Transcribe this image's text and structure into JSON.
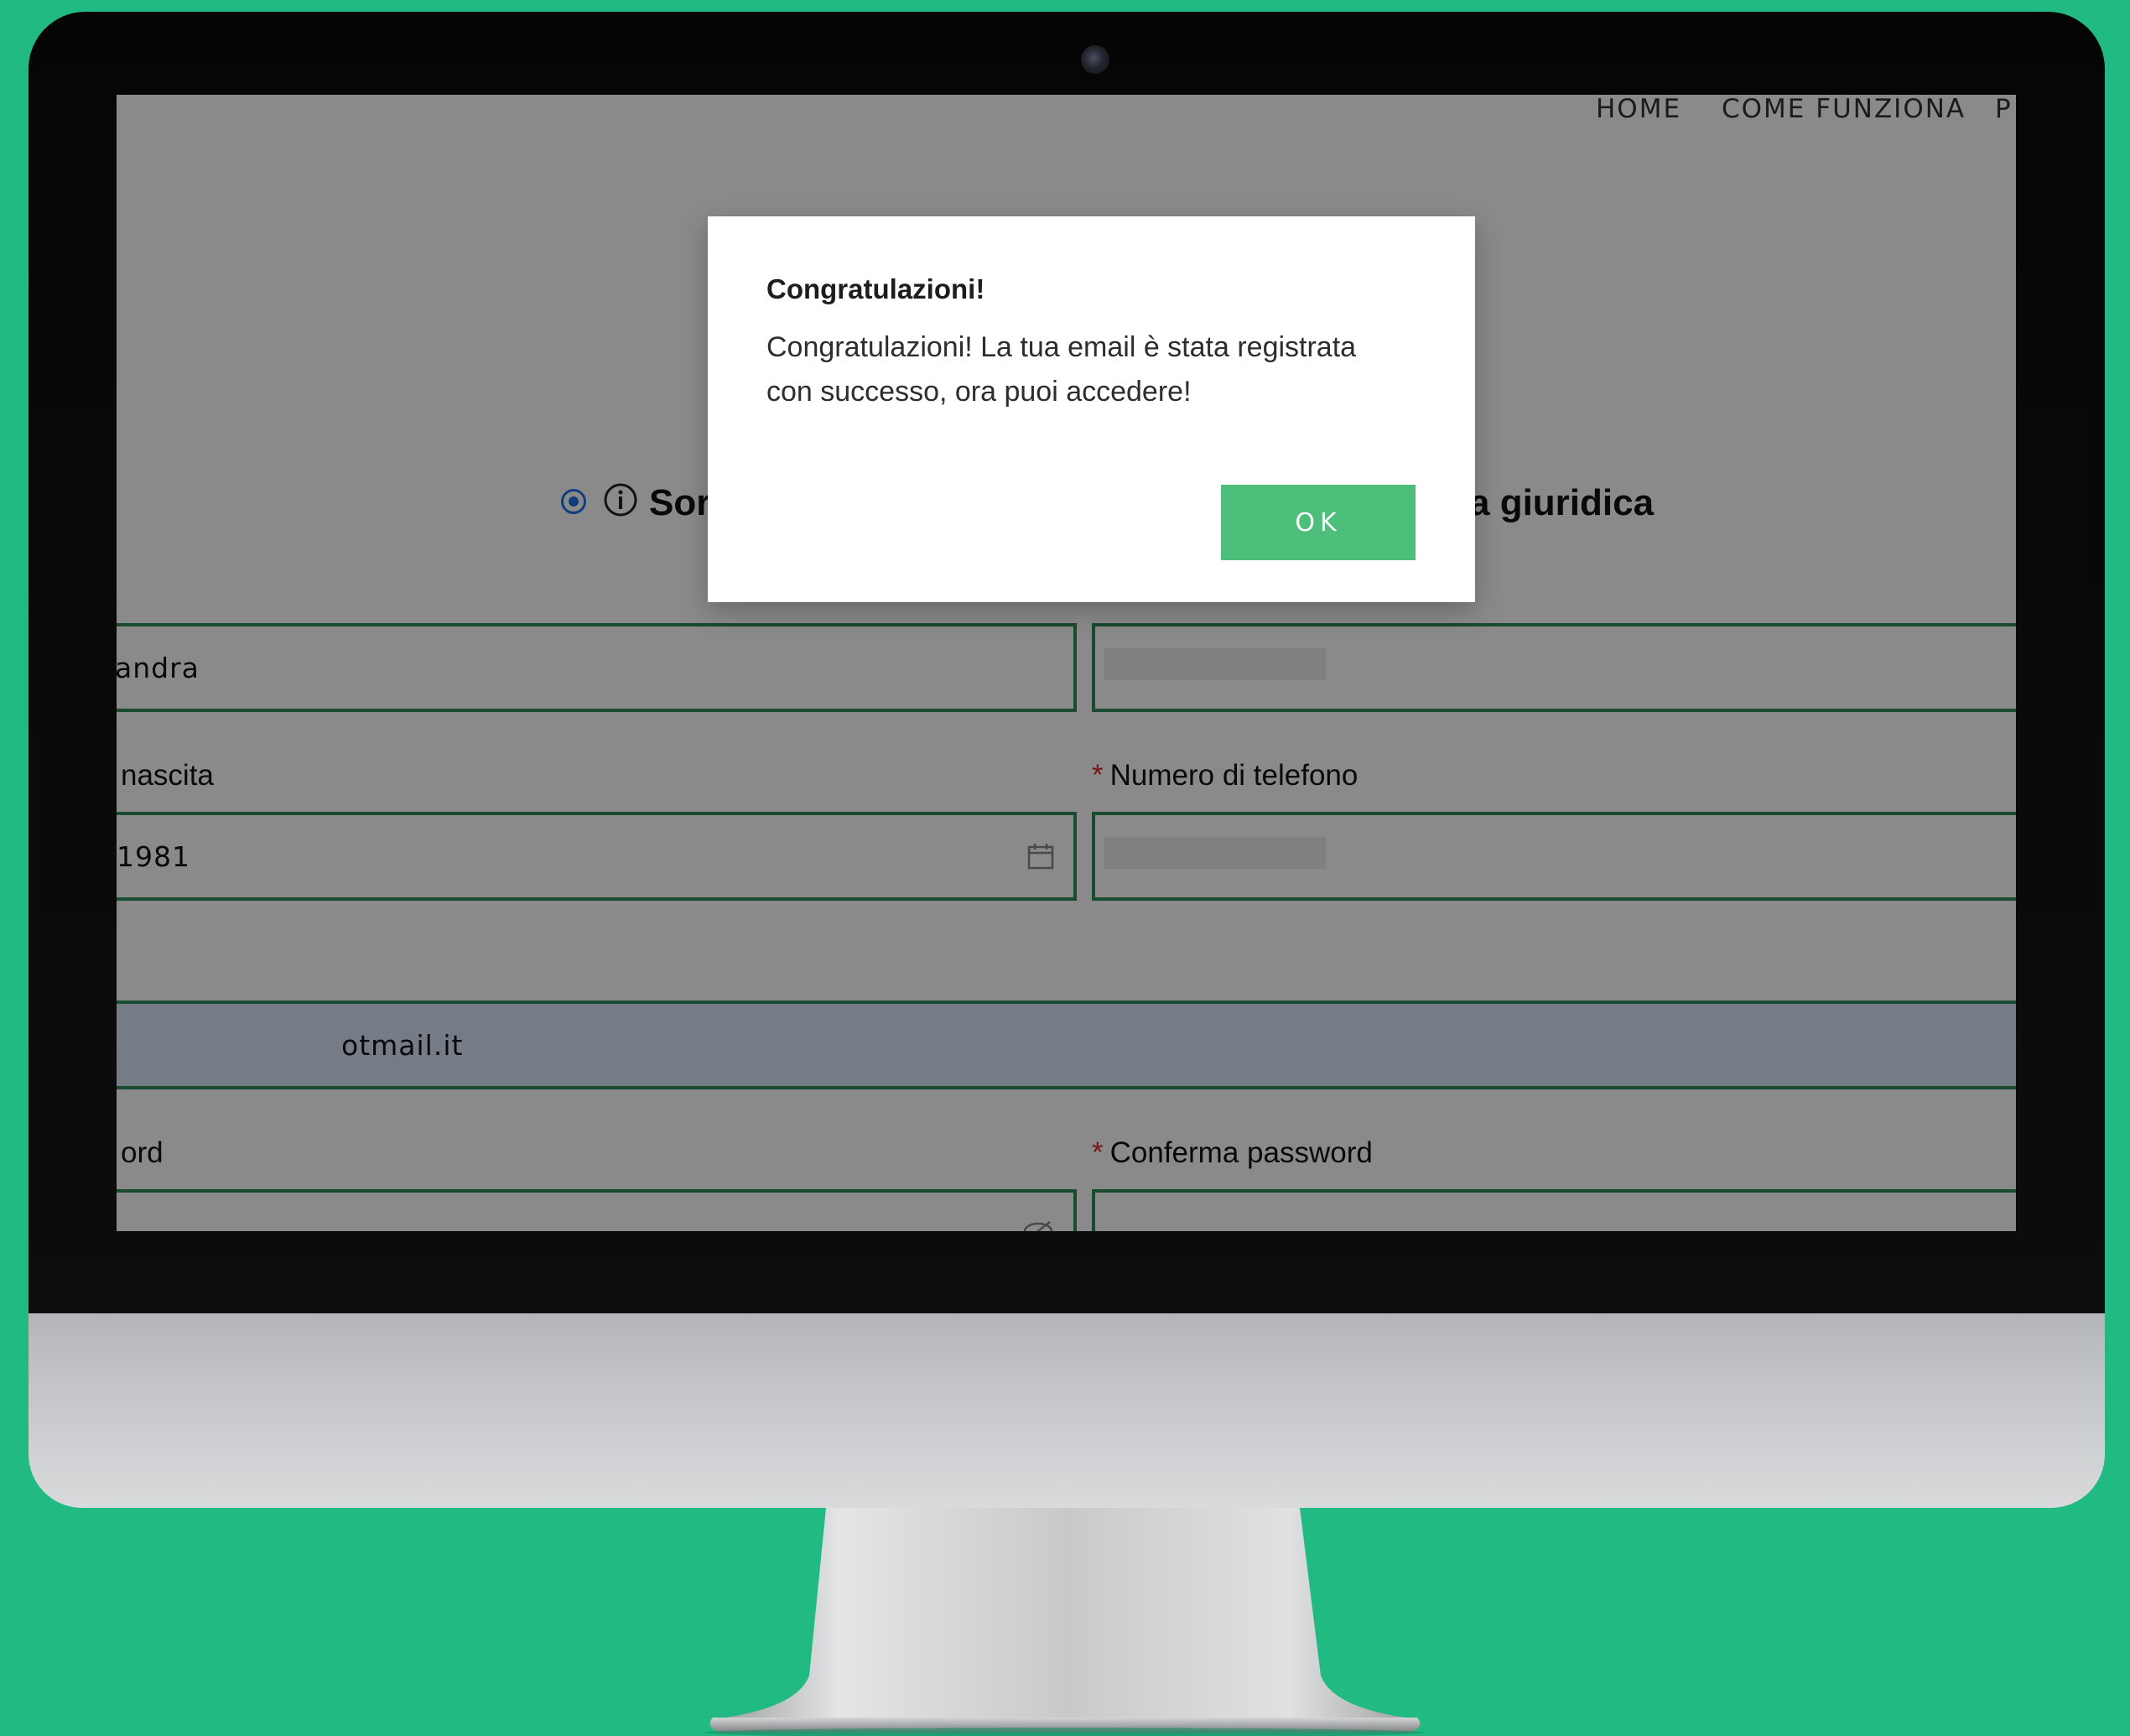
{
  "nav": {
    "items": [
      "HOME",
      "COME FUNZIONA",
      "P"
    ]
  },
  "form": {
    "radio_option_1": "Sor",
    "radio_option_2": "a giuridica",
    "first_name_value": "andra",
    "birth_label": "nascita",
    "birth_value": "1981",
    "phone_label": "Numero di telefono",
    "email_value": "otmail.it",
    "password_label": "ord",
    "confirm_password_label": "Conferma password",
    "required_marker": "*"
  },
  "dialog": {
    "title": "Congratulazioni!",
    "message": "Congratulazioni! La tua email è stata registrata con successo, ora puoi accedere!",
    "ok_label": "OK"
  },
  "colors": {
    "background": "#21ba82",
    "button": "#4ebf7b",
    "field_border": "#2e8b57",
    "radio": "#1a73e8"
  }
}
